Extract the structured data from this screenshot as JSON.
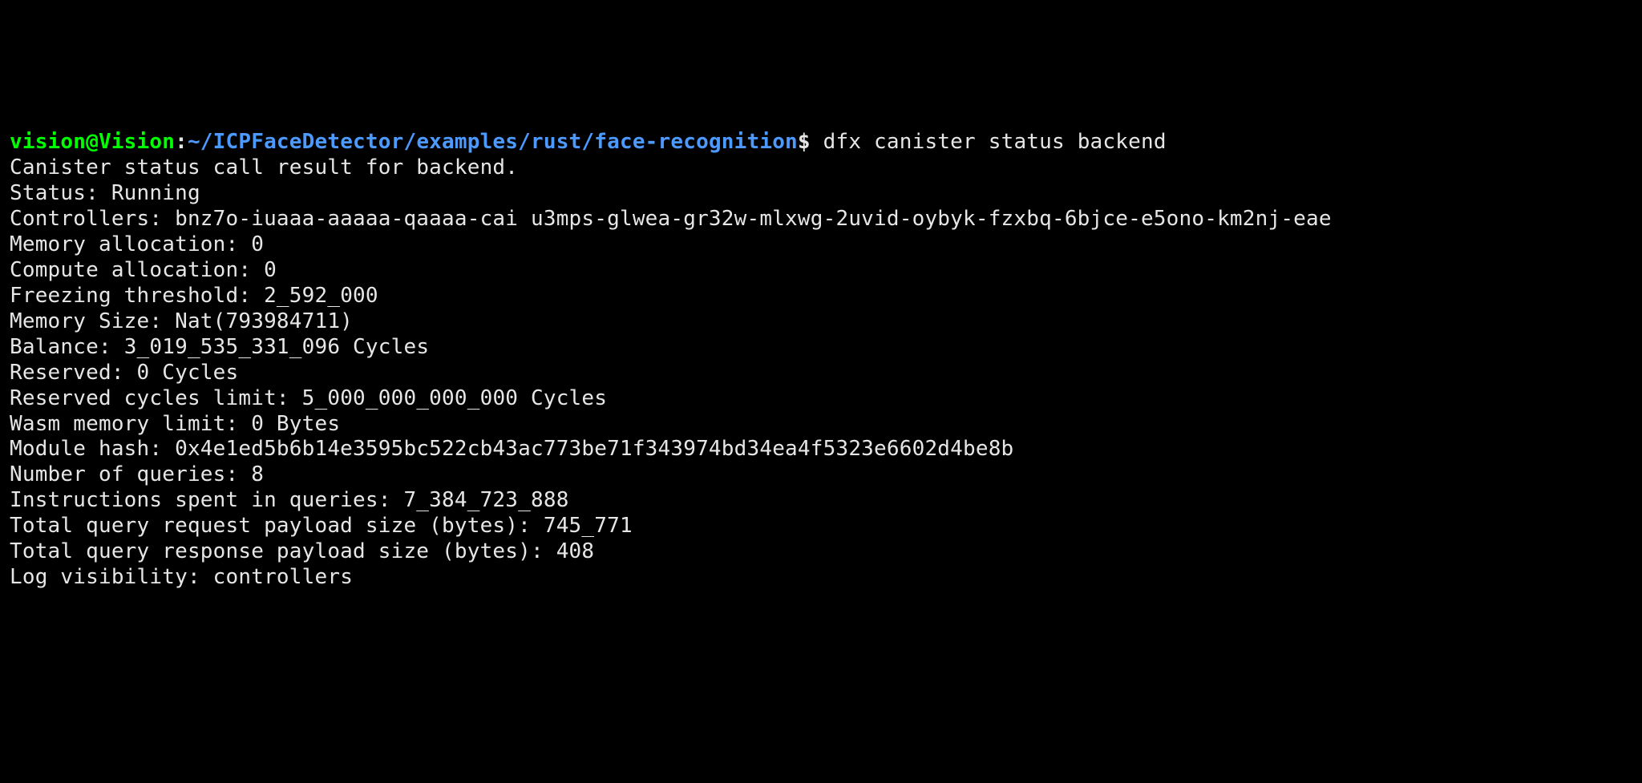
{
  "prompt": {
    "user_host": "vision@Vision",
    "sep1": ":",
    "path": "~/ICPFaceDetector/examples/rust/face-recognition",
    "sep2": "$ ",
    "command": "dfx canister status backend"
  },
  "output": {
    "header": "Canister status call result for backend.",
    "status_label": "Status: ",
    "status_value": "Running",
    "controllers_label": "Controllers: ",
    "controllers_value": "bnz7o-iuaaa-aaaaa-qaaaa-cai u3mps-glwea-gr32w-mlxwg-2uvid-oybyk-fzxbq-6bjce-e5ono-km2nj-eae",
    "memory_allocation_label": "Memory allocation: ",
    "memory_allocation_value": "0",
    "compute_allocation_label": "Compute allocation: ",
    "compute_allocation_value": "0",
    "freezing_threshold_label": "Freezing threshold: ",
    "freezing_threshold_value": "2_592_000",
    "memory_size_label": "Memory Size: ",
    "memory_size_value": "Nat(793984711)",
    "balance_label": "Balance: ",
    "balance_value": "3_019_535_331_096 Cycles",
    "reserved_label": "Reserved: ",
    "reserved_value": "0 Cycles",
    "reserved_cycles_limit_label": "Reserved cycles limit: ",
    "reserved_cycles_limit_value": "5_000_000_000_000 Cycles",
    "wasm_memory_limit_label": "Wasm memory limit: ",
    "wasm_memory_limit_value": "0 Bytes",
    "module_hash_label": "Module hash: ",
    "module_hash_value": "0x4e1ed5b6b14e3595bc522cb43ac773be71f343974bd34ea4f5323e6602d4be8b",
    "number_of_queries_label": "Number of queries: ",
    "number_of_queries_value": "8",
    "instructions_spent_label": "Instructions spent in queries: ",
    "instructions_spent_value": "7_384_723_888",
    "total_query_request_label": "Total query request payload size (bytes): ",
    "total_query_request_value": "745_771",
    "total_query_response_label": "Total query response payload size (bytes): ",
    "total_query_response_value": "408",
    "log_visibility_label": "Log visibility: ",
    "log_visibility_value": "controllers"
  }
}
